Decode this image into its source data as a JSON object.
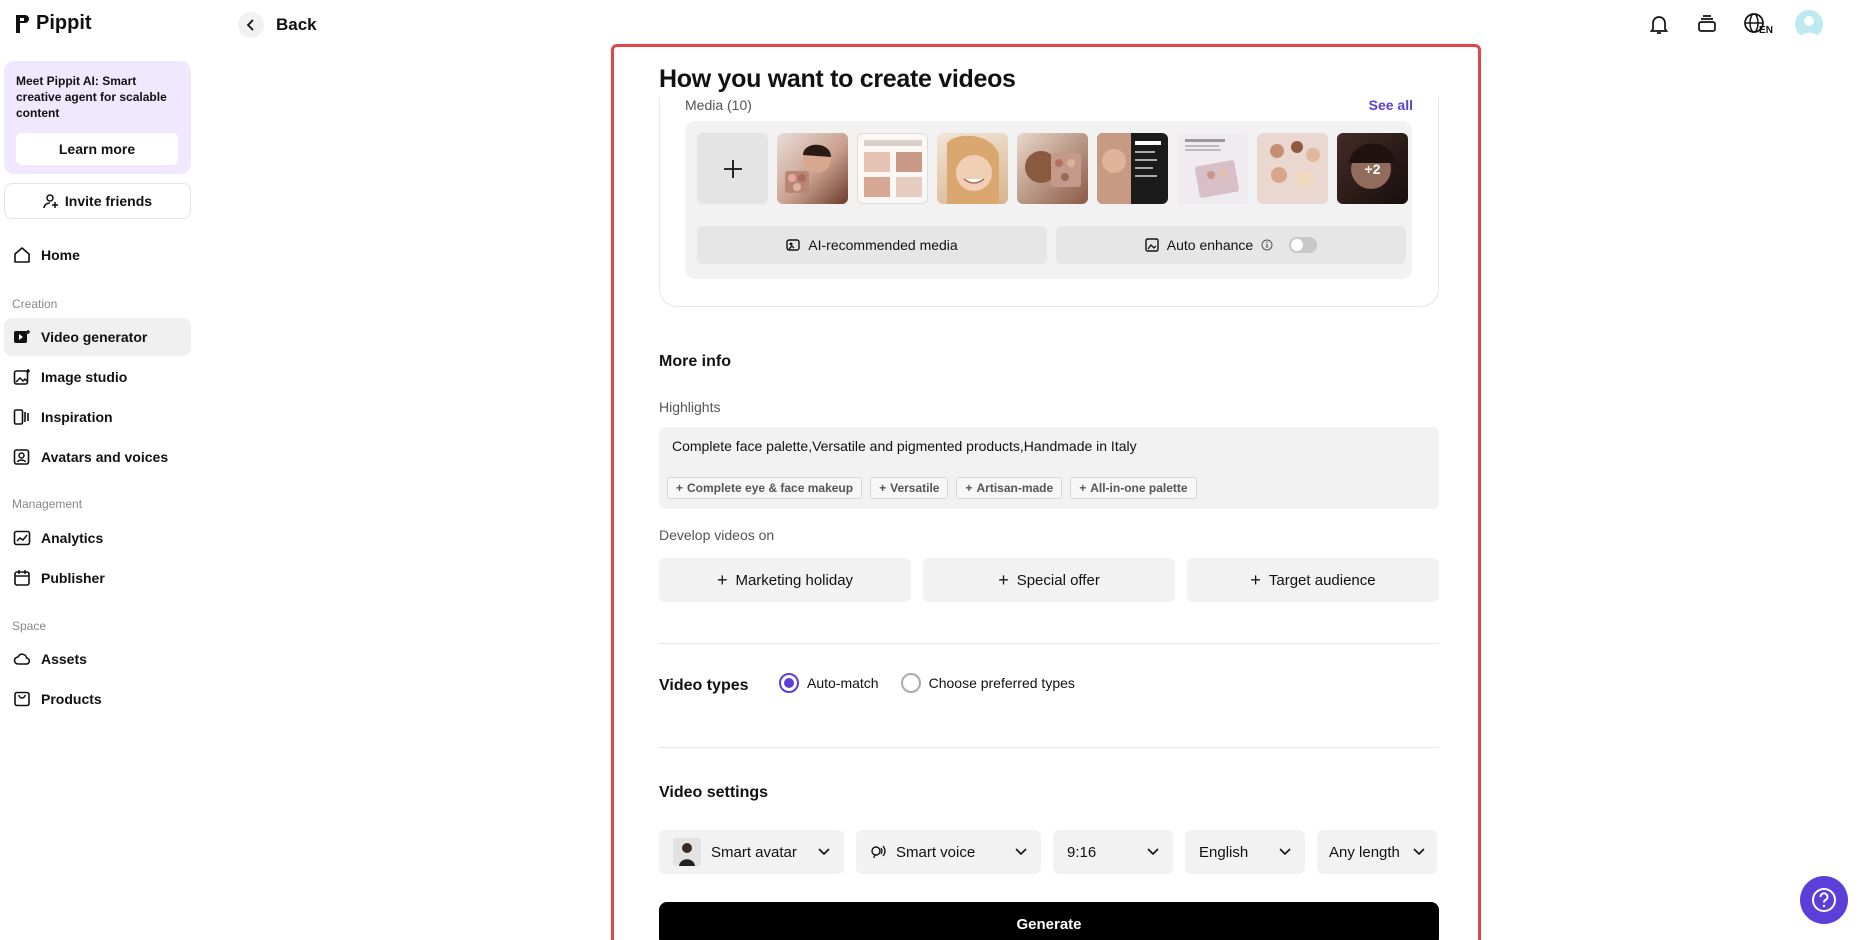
{
  "app": {
    "name": "Pippit"
  },
  "sidebar": {
    "promo": {
      "text": "Meet Pippit AI: Smart creative agent for scalable content",
      "button": "Learn more"
    },
    "invite": "Invite friends",
    "home": "Home",
    "sections": {
      "creation": "Creation",
      "management": "Management",
      "space": "Space"
    },
    "items": {
      "video_generator": "Video generator",
      "image_studio": "Image studio",
      "inspiration": "Inspiration",
      "avatars_voices": "Avatars and voices",
      "analytics": "Analytics",
      "publisher": "Publisher",
      "assets": "Assets",
      "products": "Products"
    }
  },
  "topbar": {
    "back": "Back",
    "lang": "EN"
  },
  "main": {
    "title": "How you want to create videos",
    "media": {
      "label": "Media (10)",
      "see_all": "See all",
      "more_count": "+2",
      "ai_recommended": "AI-recommended media",
      "auto_enhance": "Auto enhance"
    },
    "more_info": {
      "title": "More info",
      "highlights_label": "Highlights",
      "highlights_text": "Complete face palette,Versatile and pigmented products,Handmade in Italy",
      "chips": [
        "Complete eye & face makeup",
        "Versatile",
        "Artisan-made",
        "All-in-one palette"
      ]
    },
    "develop": {
      "label": "Develop videos on",
      "options": [
        "Marketing holiday",
        "Special offer",
        "Target audience"
      ]
    },
    "video_types": {
      "title": "Video types",
      "auto_match": "Auto-match",
      "preferred": "Choose preferred types"
    },
    "video_settings": {
      "title": "Video settings",
      "avatar": "Smart avatar",
      "voice": "Smart voice",
      "ratio": "9:16",
      "language": "English",
      "length": "Any length"
    },
    "generate": "Generate"
  },
  "colors": {
    "accent": "#5b3fd9",
    "highlight_border": "#e0464a"
  }
}
